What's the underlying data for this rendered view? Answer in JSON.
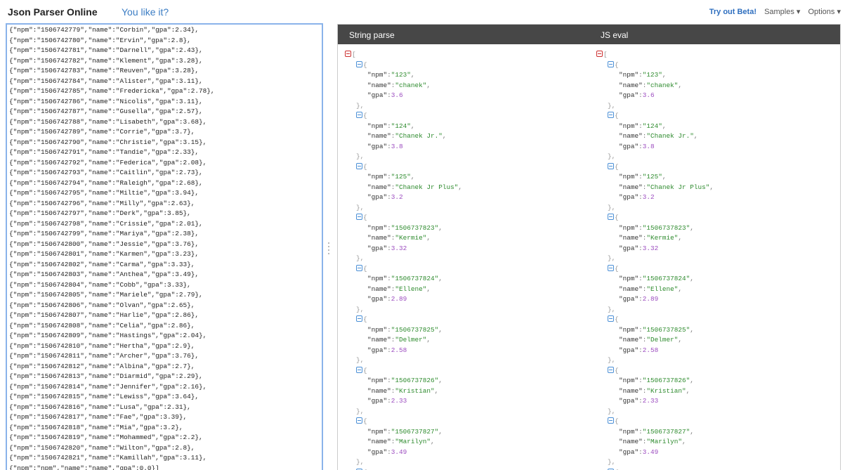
{
  "header": {
    "title": "Json Parser Online",
    "like_link": "You like it?",
    "menu": {
      "beta": "Try out Beta!",
      "samples": "Samples ▾",
      "options": "Options ▾"
    }
  },
  "editor": {
    "lines": [
      "{\"npm\":\"1506742779\",\"name\":\"Corbin\",\"gpa\":2.34},",
      "{\"npm\":\"1506742780\",\"name\":\"Ervin\",\"gpa\":2.8},",
      "{\"npm\":\"1506742781\",\"name\":\"Darnell\",\"gpa\":2.43},",
      "{\"npm\":\"1506742782\",\"name\":\"Klement\",\"gpa\":3.28},",
      "{\"npm\":\"1506742783\",\"name\":\"Reuven\",\"gpa\":3.28},",
      "{\"npm\":\"1506742784\",\"name\":\"Alister\",\"gpa\":3.11},",
      "{\"npm\":\"1506742785\",\"name\":\"Fredericka\",\"gpa\":2.78},",
      "{\"npm\":\"1506742786\",\"name\":\"Nicolis\",\"gpa\":3.11},",
      "{\"npm\":\"1506742787\",\"name\":\"Gusella\",\"gpa\":2.57},",
      "{\"npm\":\"1506742788\",\"name\":\"Lisabeth\",\"gpa\":3.68},",
      "{\"npm\":\"1506742789\",\"name\":\"Corrie\",\"gpa\":3.7},",
      "{\"npm\":\"1506742790\",\"name\":\"Christie\",\"gpa\":3.15},",
      "{\"npm\":\"1506742791\",\"name\":\"Tandie\",\"gpa\":2.33},",
      "{\"npm\":\"1506742792\",\"name\":\"Federica\",\"gpa\":2.08},",
      "{\"npm\":\"1506742793\",\"name\":\"Caitlin\",\"gpa\":2.73},",
      "{\"npm\":\"1506742794\",\"name\":\"Raleigh\",\"gpa\":2.68},",
      "{\"npm\":\"1506742795\",\"name\":\"Miltie\",\"gpa\":3.94},",
      "{\"npm\":\"1506742796\",\"name\":\"Milly\",\"gpa\":2.63},",
      "{\"npm\":\"1506742797\",\"name\":\"Derk\",\"gpa\":3.85},",
      "{\"npm\":\"1506742798\",\"name\":\"Crissie\",\"gpa\":2.01},",
      "{\"npm\":\"1506742799\",\"name\":\"Mariya\",\"gpa\":2.38},",
      "{\"npm\":\"1506742800\",\"name\":\"Jessie\",\"gpa\":3.76},",
      "{\"npm\":\"1506742801\",\"name\":\"Karmen\",\"gpa\":3.23},",
      "{\"npm\":\"1506742802\",\"name\":\"Carma\",\"gpa\":3.33},",
      "{\"npm\":\"1506742803\",\"name\":\"Anthea\",\"gpa\":3.49},",
      "{\"npm\":\"1506742804\",\"name\":\"Cobb\",\"gpa\":3.33},",
      "{\"npm\":\"1506742805\",\"name\":\"Mariele\",\"gpa\":2.79},",
      "{\"npm\":\"1506742806\",\"name\":\"Olvan\",\"gpa\":2.65},",
      "{\"npm\":\"1506742807\",\"name\":\"Harlie\",\"gpa\":2.86},",
      "{\"npm\":\"1506742808\",\"name\":\"Celia\",\"gpa\":2.86},",
      "{\"npm\":\"1506742809\",\"name\":\"Hastings\",\"gpa\":2.04},",
      "{\"npm\":\"1506742810\",\"name\":\"Hertha\",\"gpa\":2.9},",
      "{\"npm\":\"1506742811\",\"name\":\"Archer\",\"gpa\":3.76},",
      "{\"npm\":\"1506742812\",\"name\":\"Albina\",\"gpa\":2.7},",
      "{\"npm\":\"1506742813\",\"name\":\"Diarmid\",\"gpa\":2.29},",
      "{\"npm\":\"1506742814\",\"name\":\"Jennifer\",\"gpa\":2.16},",
      "{\"npm\":\"1506742815\",\"name\":\"Lewiss\",\"gpa\":3.64},",
      "{\"npm\":\"1506742816\",\"name\":\"Lusa\",\"gpa\":2.31},",
      "{\"npm\":\"1506742817\",\"name\":\"Fae\",\"gpa\":3.39},",
      "{\"npm\":\"1506742818\",\"name\":\"Mia\",\"gpa\":3.2},",
      "{\"npm\":\"1506742819\",\"name\":\"Mohammed\",\"gpa\":2.2},",
      "{\"npm\":\"1506742820\",\"name\":\"Wilton\",\"gpa\":2.8},",
      "{\"npm\":\"1506742821\",\"name\":\"Kamillah\",\"gpa\":3.11},",
      "{\"npm\":\"npm\",\"name\":\"name\",\"gpa\":0.0}]"
    ]
  },
  "viewer": {
    "columns": [
      "String parse",
      "JS eval"
    ],
    "records": [
      {
        "npm": "\"123\"",
        "name": "\"chanek\"",
        "gpa": "3.6"
      },
      {
        "npm": "\"124\"",
        "name": "\"Chanek Jr.\"",
        "gpa": "3.8"
      },
      {
        "npm": "\"125\"",
        "name": "\"Chanek Jr Plus\"",
        "gpa": "3.2"
      },
      {
        "npm": "\"1506737823\"",
        "name": "\"Kermie\"",
        "gpa": "3.32"
      },
      {
        "npm": "\"1506737824\"",
        "name": "\"Ellene\"",
        "gpa": "2.89"
      },
      {
        "npm": "\"1506737825\"",
        "name": "\"Delmer\"",
        "gpa": "2.58"
      },
      {
        "npm": "\"1506737826\"",
        "name": "\"Kristian\"",
        "gpa": "2.33"
      },
      {
        "npm": "\"1506737827\"",
        "name": "\"Marilyn\"",
        "gpa": "3.49"
      }
    ],
    "tokens": {
      "key_npm": "\"npm\"",
      "key_name": "\"name\"",
      "key_gpa": "\"gpa\"",
      "colon": ":",
      "comma": ",",
      "open_array": "[",
      "open_obj": "{",
      "close_obj": "},"
    }
  },
  "colors": {
    "accent": "#3b7dc4",
    "header_bg": "#474747",
    "string": "#2e8b2e",
    "number": "#9b4bbf",
    "editor_border": "#8ab3ea"
  }
}
